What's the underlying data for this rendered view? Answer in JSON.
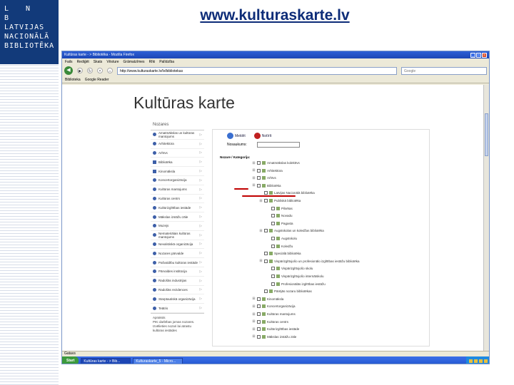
{
  "logo": {
    "line1": "L N B",
    "line2": "LATVIJAS",
    "line3": "NACIONĀLĀ",
    "line4": "BIBLIOTĒKA"
  },
  "slide_title": "www.kulturaskarte.lv",
  "browser": {
    "title": "Kultūras karte - > Bibliotēka - Mozilla Firefox",
    "menu": [
      "Fails",
      "Rediģēt",
      "Skats",
      "Vēsture",
      "Grāmatzīmes",
      "Rīki",
      "Palīdzība"
    ],
    "url": "http://www.kulturaskarte.lv/lv/bibliotekas",
    "search_placeholder": "Google",
    "bookmarks": [
      "Biblioteka",
      "Google Reader"
    ],
    "status": "Gatavs"
  },
  "site": {
    "title": "Kultūras karte"
  },
  "sidebar": {
    "header": "Nozares",
    "items": [
      "Amatmākslas un kultūras mantojums",
      "Arhitektūra",
      "Arhīvs",
      "Bibliotēka",
      "Kinomāksla",
      "Koncertorganizācija",
      "Kultūras mantojums",
      "Kultūras centrs",
      "Kultūrizglītības iestāde",
      "Mākslas izstāžu zāle",
      "Muzejs",
      "Nemateriālais kultūras mantojums",
      "Nevalstiskā organizācija",
      "Nozares pārvalde",
      "Pašvaldību kultūras iestāde",
      "Pārvaldes institūcija",
      "Radošās industrijas",
      "Radošās rezidences",
      "Starptautiskā organizācija",
      "Teātris"
    ],
    "footer_head": "Apraksts",
    "footer_text": "Pēc darbības jomas nozares. Izvēlieties nozari lai atrastu kultūras iestādes"
  },
  "panel": {
    "btn_search": "Meklēt",
    "btn_clear": "Notīrīt",
    "name_label": "Nosaukums:",
    "nozare_label": "Nozare / Kategorija:"
  },
  "tree": [
    "Amatmākslas kolektīvs",
    "Arhitektūra",
    "Arhīvs",
    "Bibliotēka",
    "Latvijas Nacionālā bibliotēka",
    "Publiskā bibliotēka",
    "Pilsētas",
    "Novadu",
    "Pagasta",
    "Augstskolas un koledžas bibliotēka",
    "Augstskolu",
    "Koledžu",
    "Speciālā bibliotēka",
    "Vispārizglītojošo un profesionālo izglītības iestāžu bibliotēka",
    "Vispārizglītojošo skolu",
    "Vispārizglītojošo internātskolu",
    "Profesionālās izglītības iestāžu",
    "Pārējās nozaru bibliotēkas",
    "Kinomāksla",
    "Koncertorganizācija",
    "Kultūras mantojums",
    "Kultūras centrs",
    "Kultūrizglītības iestāde",
    "Mākslas izstāžu zāle"
  ],
  "taskbar": {
    "start": "Start",
    "btn1": "Kultūras karte - > Bib...",
    "btn2": "Kulturaskarte_5 - Micro..."
  },
  "colors": {
    "title_blue": "#0d2c78",
    "logo_bg": "#123a7a",
    "taskbar": "#2458d0",
    "annotation_red": "#c00000"
  }
}
